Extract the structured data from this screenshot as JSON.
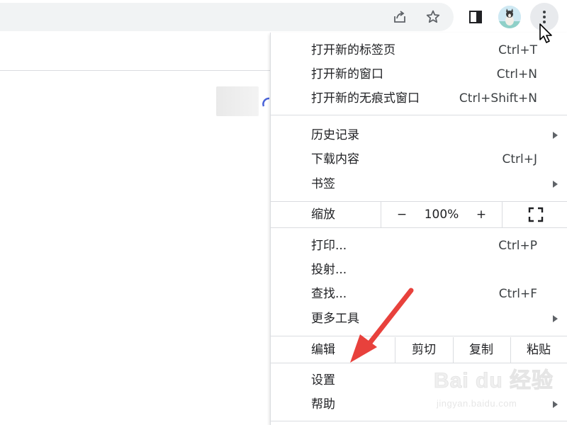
{
  "toolbar": {
    "icons": [
      "share-icon",
      "bookmark-star-icon",
      "side-panel-icon",
      "profile-avatar",
      "more-vert-icon"
    ]
  },
  "menu": {
    "group1": [
      {
        "label": "打开新的标签页",
        "shortcut": "Ctrl+T"
      },
      {
        "label": "打开新的窗口",
        "shortcut": "Ctrl+N"
      },
      {
        "label": "打开新的无痕式窗口",
        "shortcut": "Ctrl+Shift+N"
      }
    ],
    "group2": [
      {
        "label": "历史记录",
        "shortcut": "",
        "submenu": true
      },
      {
        "label": "下载内容",
        "shortcut": "Ctrl+J"
      },
      {
        "label": "书签",
        "shortcut": "",
        "submenu": true
      }
    ],
    "zoom": {
      "label": "缩放",
      "minus": "−",
      "value": "100%",
      "plus": "+"
    },
    "group3": [
      {
        "label": "打印...",
        "shortcut": "Ctrl+P"
      },
      {
        "label": "投射...",
        "shortcut": ""
      },
      {
        "label": "查找...",
        "shortcut": "Ctrl+F"
      },
      {
        "label": "更多工具",
        "shortcut": "",
        "submenu": true
      }
    ],
    "edit": {
      "label": "编辑",
      "cut": "剪切",
      "copy": "复制",
      "paste": "粘贴"
    },
    "group4": [
      {
        "label": "设置"
      },
      {
        "label": "帮助",
        "submenu": true
      }
    ]
  },
  "watermark": {
    "brand": "Bai du 经验",
    "url": "jingyan.baidu.com"
  },
  "colors": {
    "annotation_arrow": "#e8413c",
    "accent_blue": "#4a63d8",
    "menu_button_bg": "#e8eaed"
  }
}
